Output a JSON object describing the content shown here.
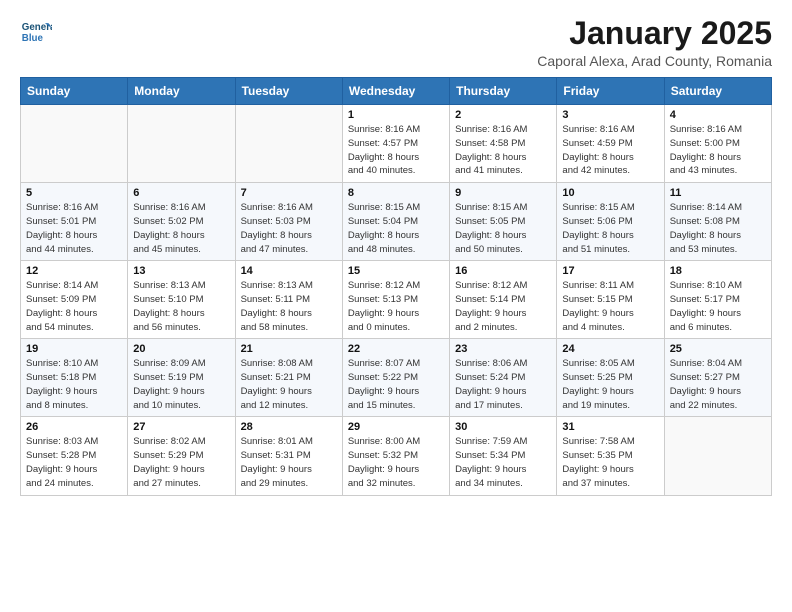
{
  "header": {
    "logo_line1": "General",
    "logo_line2": "Blue",
    "month": "January 2025",
    "location": "Caporal Alexa, Arad County, Romania"
  },
  "weekdays": [
    "Sunday",
    "Monday",
    "Tuesday",
    "Wednesday",
    "Thursday",
    "Friday",
    "Saturday"
  ],
  "weeks": [
    [
      {
        "day": "",
        "info": ""
      },
      {
        "day": "",
        "info": ""
      },
      {
        "day": "",
        "info": ""
      },
      {
        "day": "1",
        "info": "Sunrise: 8:16 AM\nSunset: 4:57 PM\nDaylight: 8 hours\nand 40 minutes."
      },
      {
        "day": "2",
        "info": "Sunrise: 8:16 AM\nSunset: 4:58 PM\nDaylight: 8 hours\nand 41 minutes."
      },
      {
        "day": "3",
        "info": "Sunrise: 8:16 AM\nSunset: 4:59 PM\nDaylight: 8 hours\nand 42 minutes."
      },
      {
        "day": "4",
        "info": "Sunrise: 8:16 AM\nSunset: 5:00 PM\nDaylight: 8 hours\nand 43 minutes."
      }
    ],
    [
      {
        "day": "5",
        "info": "Sunrise: 8:16 AM\nSunset: 5:01 PM\nDaylight: 8 hours\nand 44 minutes."
      },
      {
        "day": "6",
        "info": "Sunrise: 8:16 AM\nSunset: 5:02 PM\nDaylight: 8 hours\nand 45 minutes."
      },
      {
        "day": "7",
        "info": "Sunrise: 8:16 AM\nSunset: 5:03 PM\nDaylight: 8 hours\nand 47 minutes."
      },
      {
        "day": "8",
        "info": "Sunrise: 8:15 AM\nSunset: 5:04 PM\nDaylight: 8 hours\nand 48 minutes."
      },
      {
        "day": "9",
        "info": "Sunrise: 8:15 AM\nSunset: 5:05 PM\nDaylight: 8 hours\nand 50 minutes."
      },
      {
        "day": "10",
        "info": "Sunrise: 8:15 AM\nSunset: 5:06 PM\nDaylight: 8 hours\nand 51 minutes."
      },
      {
        "day": "11",
        "info": "Sunrise: 8:14 AM\nSunset: 5:08 PM\nDaylight: 8 hours\nand 53 minutes."
      }
    ],
    [
      {
        "day": "12",
        "info": "Sunrise: 8:14 AM\nSunset: 5:09 PM\nDaylight: 8 hours\nand 54 minutes."
      },
      {
        "day": "13",
        "info": "Sunrise: 8:13 AM\nSunset: 5:10 PM\nDaylight: 8 hours\nand 56 minutes."
      },
      {
        "day": "14",
        "info": "Sunrise: 8:13 AM\nSunset: 5:11 PM\nDaylight: 8 hours\nand 58 minutes."
      },
      {
        "day": "15",
        "info": "Sunrise: 8:12 AM\nSunset: 5:13 PM\nDaylight: 9 hours\nand 0 minutes."
      },
      {
        "day": "16",
        "info": "Sunrise: 8:12 AM\nSunset: 5:14 PM\nDaylight: 9 hours\nand 2 minutes."
      },
      {
        "day": "17",
        "info": "Sunrise: 8:11 AM\nSunset: 5:15 PM\nDaylight: 9 hours\nand 4 minutes."
      },
      {
        "day": "18",
        "info": "Sunrise: 8:10 AM\nSunset: 5:17 PM\nDaylight: 9 hours\nand 6 minutes."
      }
    ],
    [
      {
        "day": "19",
        "info": "Sunrise: 8:10 AM\nSunset: 5:18 PM\nDaylight: 9 hours\nand 8 minutes."
      },
      {
        "day": "20",
        "info": "Sunrise: 8:09 AM\nSunset: 5:19 PM\nDaylight: 9 hours\nand 10 minutes."
      },
      {
        "day": "21",
        "info": "Sunrise: 8:08 AM\nSunset: 5:21 PM\nDaylight: 9 hours\nand 12 minutes."
      },
      {
        "day": "22",
        "info": "Sunrise: 8:07 AM\nSunset: 5:22 PM\nDaylight: 9 hours\nand 15 minutes."
      },
      {
        "day": "23",
        "info": "Sunrise: 8:06 AM\nSunset: 5:24 PM\nDaylight: 9 hours\nand 17 minutes."
      },
      {
        "day": "24",
        "info": "Sunrise: 8:05 AM\nSunset: 5:25 PM\nDaylight: 9 hours\nand 19 minutes."
      },
      {
        "day": "25",
        "info": "Sunrise: 8:04 AM\nSunset: 5:27 PM\nDaylight: 9 hours\nand 22 minutes."
      }
    ],
    [
      {
        "day": "26",
        "info": "Sunrise: 8:03 AM\nSunset: 5:28 PM\nDaylight: 9 hours\nand 24 minutes."
      },
      {
        "day": "27",
        "info": "Sunrise: 8:02 AM\nSunset: 5:29 PM\nDaylight: 9 hours\nand 27 minutes."
      },
      {
        "day": "28",
        "info": "Sunrise: 8:01 AM\nSunset: 5:31 PM\nDaylight: 9 hours\nand 29 minutes."
      },
      {
        "day": "29",
        "info": "Sunrise: 8:00 AM\nSunset: 5:32 PM\nDaylight: 9 hours\nand 32 minutes."
      },
      {
        "day": "30",
        "info": "Sunrise: 7:59 AM\nSunset: 5:34 PM\nDaylight: 9 hours\nand 34 minutes."
      },
      {
        "day": "31",
        "info": "Sunrise: 7:58 AM\nSunset: 5:35 PM\nDaylight: 9 hours\nand 37 minutes."
      },
      {
        "day": "",
        "info": ""
      }
    ]
  ]
}
